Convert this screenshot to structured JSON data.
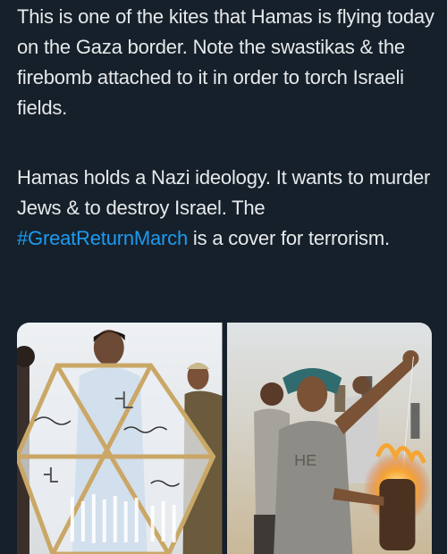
{
  "tweet": {
    "paragraph_1": "This is one of the kites that Hamas is flying today on the Gaza border. Note the swastikas & the firebomb attached to it in order to torch Israeli fields.",
    "paragraph_2_before": "Hamas holds a Nazi ideology. It wants to murder Jews & to destroy Israel. The ",
    "hashtag": "#GreatReturnMarch",
    "paragraph_2_after": " is a cover for terrorism."
  },
  "media": {
    "photo_1_label": "Men holding a large hexagonal plastic kite",
    "photo_2_label": "Man with headscarf holding a burning firebomb attached to a kite"
  },
  "colors": {
    "background": "#15202b",
    "text": "#e7e9ea",
    "link": "#1d9bf0"
  }
}
